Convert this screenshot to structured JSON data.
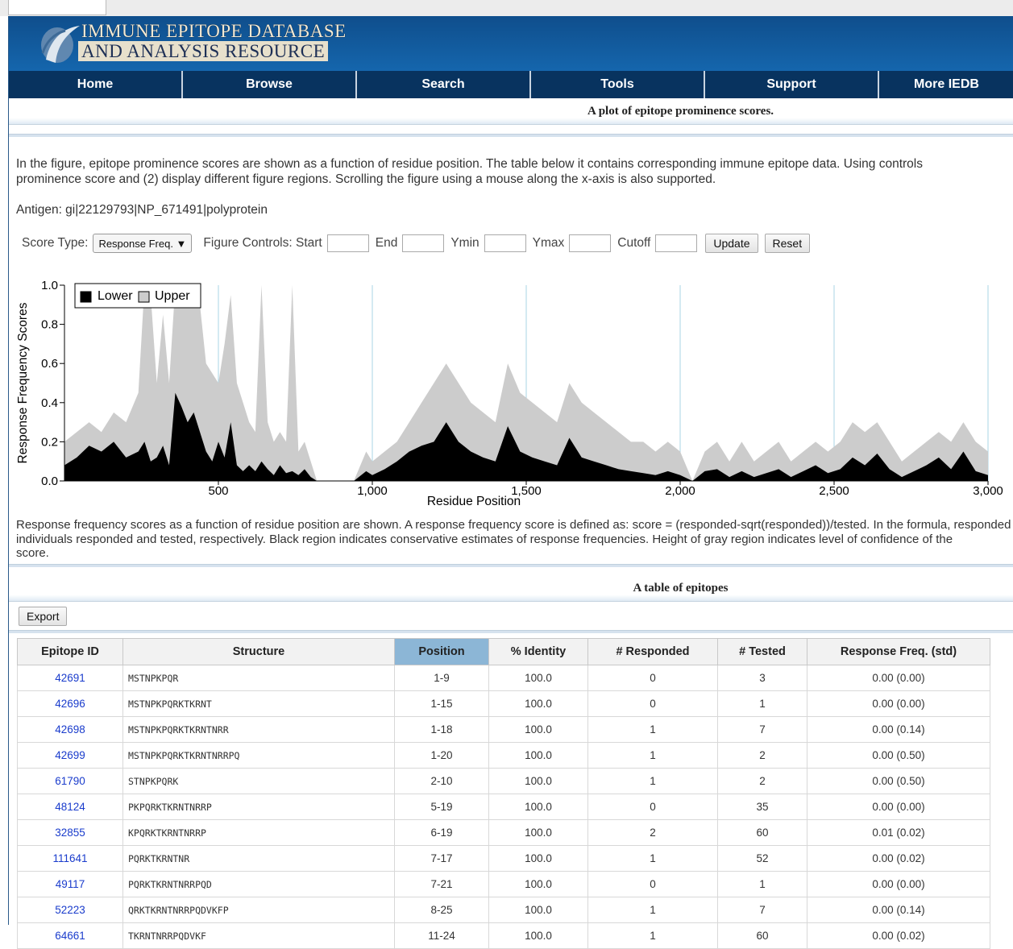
{
  "header": {
    "logo_line1": "IMMUNE EPITOPE DATABASE",
    "logo_line2": "AND ANALYSIS RESOURCE"
  },
  "nav": [
    "Home",
    "Browse",
    "Search",
    "Tools",
    "Support",
    "More IEDB"
  ],
  "plot_section": {
    "title": "A plot of epitope prominence scores.",
    "intro_line1": "In the figure, epitope prominence scores are shown as a function of residue position. The table below it contains corresponding immune epitope data. Using controls",
    "intro_line2": "prominence score and (2) display different figure regions. Scrolling the figure using a mouse along the x-axis is also supported.",
    "antigen": "Antigen: gi|22129793|NP_671491|polyprotein"
  },
  "controls": {
    "score_type_label": "Score Type:",
    "score_type_value": "Response Freq. ▼",
    "figure_controls_label": "Figure Controls: Start",
    "end_label": "End",
    "ymin_label": "Ymin",
    "ymax_label": "Ymax",
    "cutoff_label": "Cutoff",
    "update_button": "Update",
    "reset_button": "Reset"
  },
  "chart_data": {
    "type": "area",
    "xlabel": "Residue Position",
    "ylabel": "Response Frequency Scores",
    "xlim": [
      0,
      3000
    ],
    "ylim": [
      0,
      1.0
    ],
    "x_ticks": [
      500,
      1000,
      1500,
      2000,
      2500,
      3000
    ],
    "x_tick_labels": [
      "500",
      "1,000",
      "1,500",
      "2,000",
      "2,500",
      "3,000"
    ],
    "y_ticks": [
      0.0,
      0.2,
      0.4,
      0.6,
      0.8,
      1.0
    ],
    "y_tick_labels": [
      "0.0",
      "0.2",
      "0.4",
      "0.6",
      "0.8",
      "1.0"
    ],
    "legend": [
      "Lower",
      "Upper"
    ],
    "legend_position": "top-left",
    "colors": {
      "lower": "#000000",
      "upper": "#cccccc",
      "marker": "#a8d4e6"
    },
    "marker_lines_x": [
      500,
      1000,
      1500,
      2000,
      2500,
      3000
    ],
    "series": [
      {
        "name": "Upper",
        "x": [
          0,
          40,
          80,
          120,
          160,
          200,
          240,
          260,
          280,
          300,
          320,
          340,
          360,
          380,
          400,
          420,
          440,
          460,
          480,
          500,
          520,
          540,
          560,
          580,
          600,
          620,
          640,
          660,
          680,
          700,
          720,
          740,
          760,
          780,
          800,
          820,
          860,
          900,
          940,
          980,
          1000,
          1040,
          1080,
          1120,
          1160,
          1200,
          1240,
          1280,
          1320,
          1360,
          1400,
          1440,
          1480,
          1520,
          1560,
          1600,
          1640,
          1680,
          1720,
          1760,
          1800,
          1840,
          1880,
          1920,
          1960,
          2000,
          2040,
          2080,
          2120,
          2160,
          2200,
          2240,
          2280,
          2320,
          2360,
          2400,
          2440,
          2480,
          2520,
          2560,
          2600,
          2640,
          2680,
          2720,
          2760,
          2800,
          2840,
          2880,
          2920,
          2960,
          3000
        ],
        "values": [
          0.2,
          0.25,
          0.3,
          0.25,
          0.35,
          0.3,
          0.45,
          1.0,
          0.95,
          0.5,
          0.85,
          0.5,
          1.0,
          1.0,
          1.0,
          1.0,
          0.9,
          0.6,
          0.55,
          0.5,
          0.7,
          0.95,
          0.5,
          0.4,
          0.3,
          0.25,
          1.0,
          0.3,
          0.2,
          0.25,
          0.2,
          1.0,
          0.15,
          0.2,
          0.1,
          0.0,
          0.0,
          0.0,
          0.0,
          0.15,
          0.1,
          0.15,
          0.2,
          0.3,
          0.4,
          0.5,
          0.6,
          0.5,
          0.4,
          0.35,
          0.3,
          0.6,
          0.45,
          0.4,
          0.35,
          0.3,
          0.5,
          0.4,
          0.35,
          0.3,
          0.25,
          0.2,
          0.2,
          0.15,
          0.2,
          0.15,
          0.0,
          0.15,
          0.2,
          0.1,
          0.2,
          0.1,
          0.15,
          0.2,
          0.1,
          0.15,
          0.2,
          0.15,
          0.2,
          0.3,
          0.25,
          0.3,
          0.2,
          0.1,
          0.15,
          0.2,
          0.25,
          0.2,
          0.3,
          0.2,
          0.15
        ]
      },
      {
        "name": "Lower",
        "x": [
          0,
          40,
          80,
          120,
          160,
          200,
          240,
          260,
          280,
          300,
          320,
          340,
          360,
          380,
          400,
          420,
          440,
          460,
          480,
          500,
          520,
          540,
          560,
          580,
          600,
          620,
          640,
          660,
          680,
          700,
          720,
          740,
          760,
          780,
          800,
          820,
          860,
          900,
          940,
          980,
          1000,
          1040,
          1080,
          1120,
          1160,
          1200,
          1240,
          1280,
          1320,
          1360,
          1400,
          1440,
          1480,
          1520,
          1560,
          1600,
          1640,
          1680,
          1720,
          1760,
          1800,
          1840,
          1880,
          1920,
          1960,
          2000,
          2040,
          2080,
          2120,
          2160,
          2200,
          2240,
          2280,
          2320,
          2360,
          2400,
          2440,
          2480,
          2520,
          2560,
          2600,
          2640,
          2680,
          2720,
          2760,
          2800,
          2840,
          2880,
          2920,
          2960,
          3000
        ],
        "values": [
          0.08,
          0.12,
          0.18,
          0.15,
          0.2,
          0.12,
          0.15,
          0.2,
          0.1,
          0.12,
          0.18,
          0.08,
          0.45,
          0.38,
          0.3,
          0.35,
          0.25,
          0.15,
          0.1,
          0.2,
          0.12,
          0.3,
          0.08,
          0.05,
          0.08,
          0.05,
          0.1,
          0.06,
          0.03,
          0.08,
          0.04,
          0.05,
          0.03,
          0.06,
          0.02,
          0.0,
          0.0,
          0.0,
          0.0,
          0.05,
          0.03,
          0.06,
          0.1,
          0.15,
          0.18,
          0.2,
          0.3,
          0.2,
          0.15,
          0.12,
          0.1,
          0.28,
          0.15,
          0.12,
          0.1,
          0.08,
          0.22,
          0.12,
          0.1,
          0.08,
          0.06,
          0.05,
          0.04,
          0.03,
          0.05,
          0.03,
          0.0,
          0.05,
          0.06,
          0.02,
          0.05,
          0.02,
          0.04,
          0.06,
          0.02,
          0.05,
          0.08,
          0.04,
          0.06,
          0.12,
          0.08,
          0.14,
          0.06,
          0.02,
          0.05,
          0.08,
          0.12,
          0.06,
          0.15,
          0.05,
          0.03
        ]
      }
    ]
  },
  "caption": {
    "line1": "Response frequency scores as a function of residue position are shown. A response frequency score is defined as: score = (responded-sqrt(responded))/tested. In the formula, responded",
    "line2": "individuals responded and tested, respectively. Black region indicates conservative estimates of response frequencies. Height of gray region indicates level of confidence of the",
    "line3": "score."
  },
  "table_section": {
    "title": "A table of epitopes",
    "export_button": "Export",
    "columns": [
      "Epitope ID",
      "Structure",
      "Position",
      "% Identity",
      "# Responded",
      "# Tested",
      "Response Freq. (std)"
    ],
    "rows": [
      [
        "42691",
        "MSTNPKPQR",
        "1-9",
        "100.0",
        "0",
        "3",
        "0.00 (0.00)"
      ],
      [
        "42696",
        "MSTNPKPQRKTKRNT",
        "1-15",
        "100.0",
        "0",
        "1",
        "0.00 (0.00)"
      ],
      [
        "42698",
        "MSTNPKPQRKTKRNTNRR",
        "1-18",
        "100.0",
        "1",
        "7",
        "0.00 (0.14)"
      ],
      [
        "42699",
        "MSTNPKPQRKTKRNTNRRPQ",
        "1-20",
        "100.0",
        "1",
        "2",
        "0.00 (0.50)"
      ],
      [
        "61790",
        "STNPKPQRK",
        "2-10",
        "100.0",
        "1",
        "2",
        "0.00 (0.50)"
      ],
      [
        "48124",
        "PKPQRKTKRNTNRRP",
        "5-19",
        "100.0",
        "0",
        "35",
        "0.00 (0.00)"
      ],
      [
        "32855",
        "KPQRKTKRNTNRRP",
        "6-19",
        "100.0",
        "2",
        "60",
        "0.01 (0.02)"
      ],
      [
        "111641",
        "PQRKTKRNTNR",
        "7-17",
        "100.0",
        "1",
        "52",
        "0.00 (0.02)"
      ],
      [
        "49117",
        "PQRKTKRNTNRRPQD",
        "7-21",
        "100.0",
        "0",
        "1",
        "0.00 (0.00)"
      ],
      [
        "52223",
        "QRKTKRNTNRRPQDVKFP",
        "8-25",
        "100.0",
        "1",
        "7",
        "0.00 (0.14)"
      ],
      [
        "64661",
        "TKRNTNRRPQDVKF",
        "11-24",
        "100.0",
        "1",
        "60",
        "0.00 (0.02)"
      ]
    ]
  }
}
